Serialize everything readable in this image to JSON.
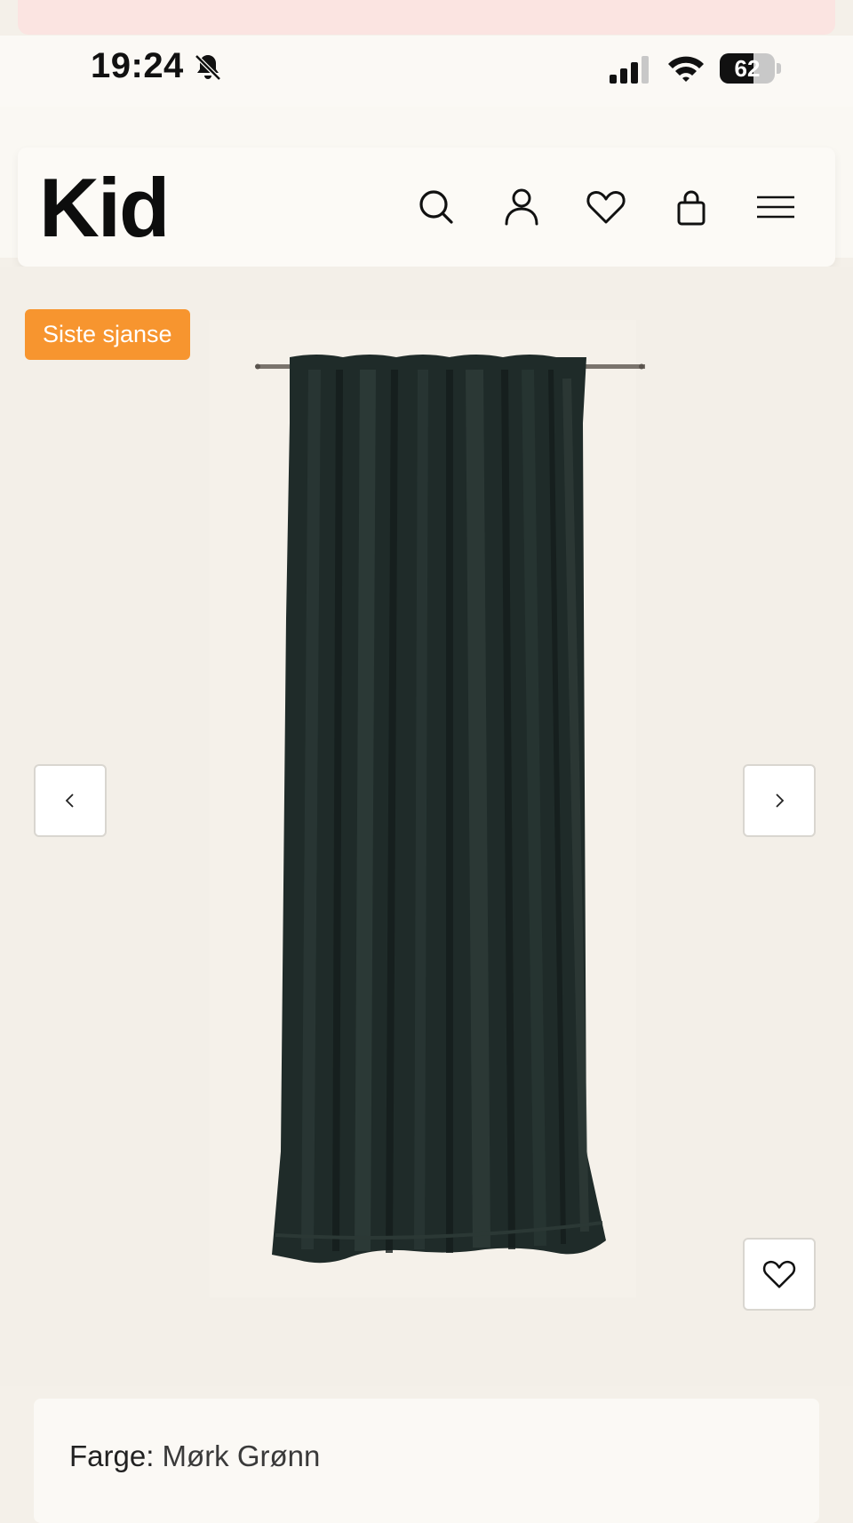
{
  "status_bar": {
    "time": "19:24",
    "battery_level": "62",
    "battery_fraction": 0.62,
    "icons": [
      "bell-muted-icon",
      "cellular-signal-icon",
      "wifi-icon",
      "battery-icon"
    ]
  },
  "header": {
    "logo": "Kid",
    "icons": [
      "search-icon",
      "account-icon",
      "wishlist-heart-icon",
      "shopping-bag-icon",
      "menu-icon"
    ]
  },
  "product": {
    "badge": "Siste sjanse",
    "image_alt": "curtain-image",
    "nav_icons": [
      "chevron-left-icon",
      "chevron-right-icon"
    ],
    "wishlist_icon": "heart-icon"
  },
  "details": {
    "color_label": "Farge:",
    "color_value": "Mørk Grønn"
  },
  "colors": {
    "badge": "#f7952f",
    "background": "#f3efe8",
    "curtain": "#1f2b29"
  }
}
